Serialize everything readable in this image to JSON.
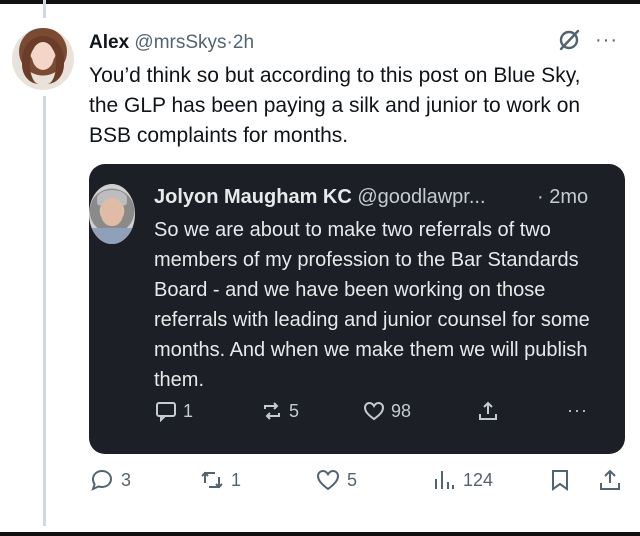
{
  "post": {
    "author_name": "Alex",
    "handle": "@mrsSkys",
    "separator": "·",
    "time": "2h",
    "text": "You’d think so but according to this post on Blue Sky, the GLP has been paying a silk and junior to work on BSB complaints for months.",
    "more_icon": "···"
  },
  "quote": {
    "author_name": "Jolyon Maugham KC",
    "handle": "@goodlawpr...",
    "time": "· 2mo",
    "text": "So we are about to make two referrals of two members of my profession to the Bar Standards Board - and we have been working on those referrals with leading and junior counsel for some months. And when we make them we will publish them.",
    "replies": "1",
    "reposts": "5",
    "likes": "98",
    "more_icon": "···"
  },
  "actions": {
    "replies": "3",
    "reposts": "1",
    "likes": "5",
    "views": "124"
  },
  "colors": {
    "quote_bg": "#1c1f26",
    "muted": "#536471",
    "thread_line": "#cfd9de"
  }
}
